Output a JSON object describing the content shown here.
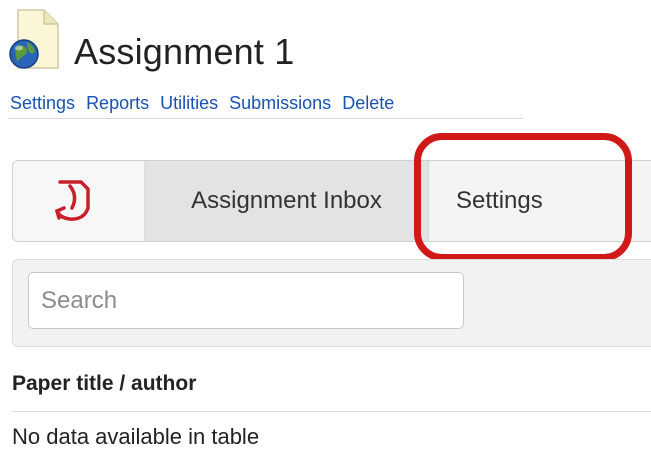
{
  "page": {
    "title": "Assignment 1"
  },
  "icons": {
    "document": "document-globe-icon",
    "turnitin": "turnitin-logo-icon"
  },
  "links": {
    "settings": "Settings",
    "reports": "Reports",
    "utilities": "Utilities",
    "submissions": "Submissions",
    "delete": "Delete"
  },
  "tabs": {
    "inbox": "Assignment Inbox",
    "settings": "Settings"
  },
  "search": {
    "placeholder": "Search",
    "value": ""
  },
  "table": {
    "headers": [
      "Paper title / author"
    ],
    "empty_message": "No data available in table"
  },
  "colors": {
    "link": "#1a52b4",
    "highlight": "#d11818",
    "logo_red": "#c8202a"
  }
}
